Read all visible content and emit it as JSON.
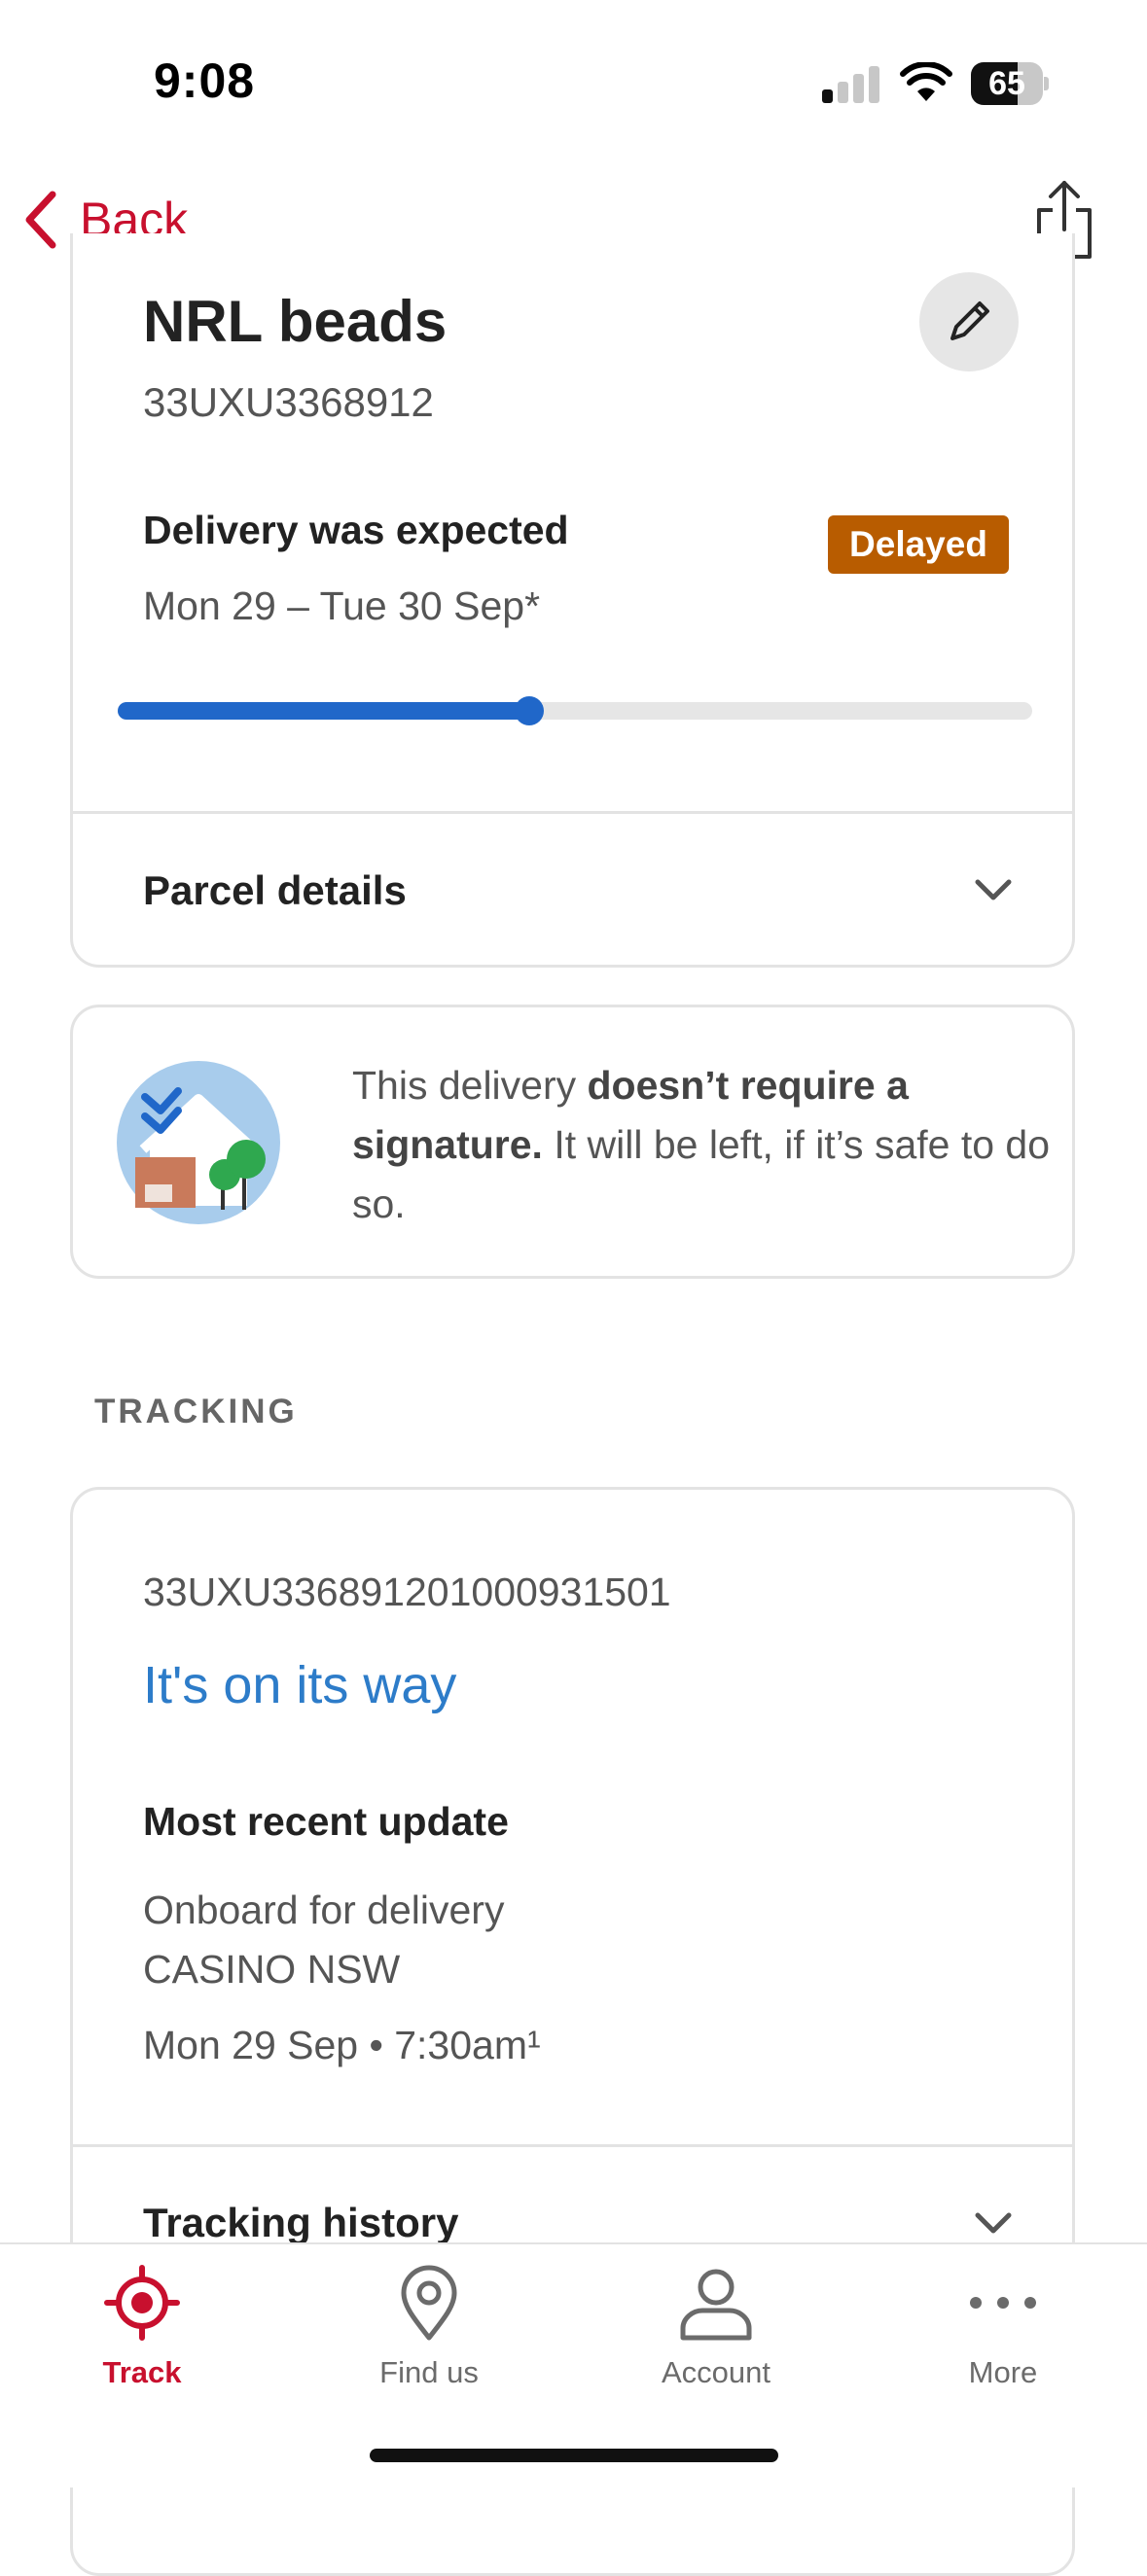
{
  "status_bar": {
    "time": "9:08",
    "battery": "65",
    "battery_level": 0.65
  },
  "nav": {
    "back_label": "Back"
  },
  "parcel": {
    "title": "NRL beads",
    "id": "33UXU3368912",
    "expected_label": "Delivery was expected",
    "expected_dates": "Mon 29 – Tue 30 Sep*",
    "badge": "Delayed",
    "badge_color": "#b85c00",
    "progress": 0.45,
    "details_label": "Parcel details"
  },
  "signature": {
    "text_before": "This delivery ",
    "text_bold": "doesn’t require a signature.",
    "text_after": " It will be left, if it’s safe to do so."
  },
  "tracking": {
    "section_title": "TRACKING",
    "number": "33UXU336891201000931501",
    "status": "It's on its way",
    "recent_label": "Most recent update",
    "event_line1": "Onboard for delivery",
    "event_line2": "CASINO NSW",
    "event_time": "Mon 29 Sep • 7:30am¹",
    "history_label": "Tracking history"
  },
  "tabs": [
    {
      "label": "Track",
      "icon": "crosshair-icon",
      "active": true
    },
    {
      "label": "Find us",
      "icon": "location-pin-icon",
      "active": false
    },
    {
      "label": "Account",
      "icon": "person-icon",
      "active": false
    },
    {
      "label": "More",
      "icon": "more-dots-icon",
      "active": false
    }
  ],
  "colors": {
    "brand": "#c8102e",
    "progress": "#2067c9",
    "link": "#2d7cc9"
  }
}
